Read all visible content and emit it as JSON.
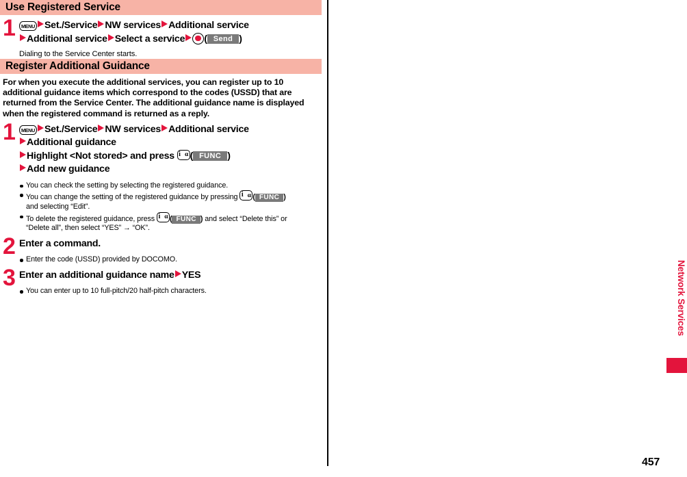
{
  "page": {
    "number": "457",
    "side_tab_label": "Network Services"
  },
  "sections": [
    {
      "heading": "Use Registered Service",
      "steps": [
        {
          "number": "1",
          "lines": [
            {
              "parts": [
                {
                  "type": "key",
                  "icon": "menu-key-icon",
                  "label": "MENU"
                },
                {
                  "type": "tri"
                },
                {
                  "type": "text",
                  "text": "Set./Service"
                },
                {
                  "type": "tri"
                },
                {
                  "type": "text",
                  "text": "NW services"
                },
                {
                  "type": "tri"
                },
                {
                  "type": "text",
                  "text": "Additional service"
                }
              ]
            },
            {
              "parts": [
                {
                  "type": "tri"
                },
                {
                  "type": "text",
                  "text": "Additional service"
                },
                {
                  "type": "tri"
                },
                {
                  "type": "text",
                  "text": "Select a service"
                },
                {
                  "type": "tri"
                },
                {
                  "type": "key",
                  "icon": "center-select-key-icon"
                },
                {
                  "type": "paren_open",
                  "text": "("
                },
                {
                  "type": "softkey",
                  "label": "Send"
                },
                {
                  "type": "paren_close",
                  "text": ")"
                }
              ]
            }
          ],
          "note": "Dialing to the Service Center starts."
        }
      ]
    },
    {
      "heading": "Register Additional Guidance",
      "intro": "For when you execute the additional services, you can register up to 10 additional guidance items which correspond to the codes (USSD) that are returned from the Service Center. The additional guidance name is displayed when the registered command is returned as a reply.",
      "steps": [
        {
          "number": "1",
          "lines": [
            {
              "parts": [
                {
                  "type": "key",
                  "icon": "menu-key-icon",
                  "label": "MENU"
                },
                {
                  "type": "tri"
                },
                {
                  "type": "text",
                  "text": "Set./Service"
                },
                {
                  "type": "tri"
                },
                {
                  "type": "text",
                  "text": "NW services"
                },
                {
                  "type": "tri"
                },
                {
                  "type": "text",
                  "text": "Additional service"
                }
              ]
            },
            {
              "parts": [
                {
                  "type": "tri"
                },
                {
                  "type": "text",
                  "text": "Additional guidance"
                }
              ]
            },
            {
              "parts": [
                {
                  "type": "tri"
                },
                {
                  "type": "text",
                  "text": "Highlight <Not stored> and press "
                },
                {
                  "type": "key",
                  "icon": "i-alpha-key-icon"
                },
                {
                  "type": "paren_open",
                  "text": "("
                },
                {
                  "type": "softkey",
                  "label": "FUNC"
                },
                {
                  "type": "paren_close",
                  "text": ")"
                }
              ]
            },
            {
              "parts": [
                {
                  "type": "tri"
                },
                {
                  "type": "text",
                  "text": "Add new guidance"
                }
              ]
            }
          ],
          "bullets": [
            {
              "parts": [
                {
                  "type": "text",
                  "text": "You can check the setting by selecting the registered guidance."
                }
              ]
            },
            {
              "parts": [
                {
                  "type": "text",
                  "text": "You can change the setting of the registered guidance by pressing "
                },
                {
                  "type": "key",
                  "icon": "i-alpha-key-icon"
                },
                {
                  "type": "paren_open",
                  "text": "("
                },
                {
                  "type": "softkey_small",
                  "label": "FUNC"
                },
                {
                  "type": "paren_close",
                  "text": ")"
                },
                {
                  "type": "break"
                },
                {
                  "type": "text",
                  "text": "and selecting “Edit”."
                }
              ]
            },
            {
              "parts": [
                {
                  "type": "text",
                  "text": "To delete the registered guidance, press "
                },
                {
                  "type": "key",
                  "icon": "i-alpha-key-icon"
                },
                {
                  "type": "paren_open",
                  "text": "("
                },
                {
                  "type": "softkey_small",
                  "label": "FUNC"
                },
                {
                  "type": "paren_close",
                  "text": ")"
                },
                {
                  "type": "text",
                  "text": " and select “Delete this” or"
                },
                {
                  "type": "break"
                },
                {
                  "type": "text",
                  "text": "“Delete all”, then select “YES” → “OK”."
                }
              ]
            }
          ]
        },
        {
          "number": "2",
          "lines": [
            {
              "parts": [
                {
                  "type": "text",
                  "text": "Enter a command."
                }
              ]
            }
          ],
          "bullets": [
            {
              "parts": [
                {
                  "type": "text",
                  "text": "Enter the code (USSD) provided by DOCOMO."
                }
              ]
            }
          ]
        },
        {
          "number": "3",
          "lines": [
            {
              "parts": [
                {
                  "type": "text",
                  "text": "Enter an additional guidance name"
                },
                {
                  "type": "tri"
                },
                {
                  "type": "text",
                  "text": "YES"
                }
              ]
            }
          ],
          "bullets": [
            {
              "parts": [
                {
                  "type": "text",
                  "text": "You can enter up to 10 full-pitch/20 half-pitch characters."
                }
              ]
            }
          ]
        }
      ]
    }
  ],
  "colors": {
    "heading_bar": "#f7b3a6",
    "accent_red": "#e3143c",
    "softkey_gray": "#7a7a7a"
  }
}
